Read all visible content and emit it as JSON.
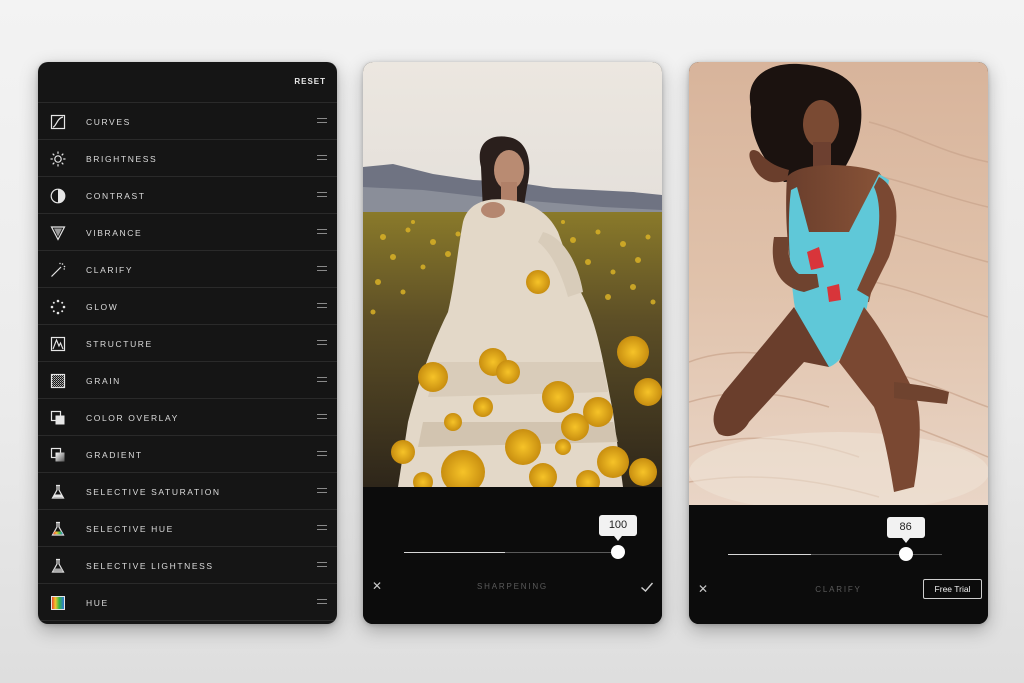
{
  "tools_panel": {
    "reset_label": "RESET",
    "items": [
      {
        "label": "CURVES",
        "icon": "curves-icon"
      },
      {
        "label": "BRIGHTNESS",
        "icon": "brightness-icon"
      },
      {
        "label": "CONTRAST",
        "icon": "contrast-icon"
      },
      {
        "label": "VIBRANCE",
        "icon": "vibrance-icon"
      },
      {
        "label": "CLARIFY",
        "icon": "clarify-icon"
      },
      {
        "label": "GLOW",
        "icon": "glow-icon"
      },
      {
        "label": "STRUCTURE",
        "icon": "structure-icon"
      },
      {
        "label": "GRAIN",
        "icon": "grain-icon"
      },
      {
        "label": "COLOR OVERLAY",
        "icon": "color-overlay-icon"
      },
      {
        "label": "GRADIENT",
        "icon": "gradient-icon"
      },
      {
        "label": "SELECTIVE SATURATION",
        "icon": "selective-saturation-icon"
      },
      {
        "label": "SELECTIVE HUE",
        "icon": "selective-hue-icon"
      },
      {
        "label": "SELECTIVE LIGHTNESS",
        "icon": "selective-lightness-icon"
      },
      {
        "label": "HUE",
        "icon": "hue-icon"
      }
    ]
  },
  "sharpen_panel": {
    "tool_name": "SHARPENING",
    "value": "100",
    "slider_fraction": 1.0,
    "close_icon": "close-icon",
    "apply_icon": "checkmark-icon"
  },
  "clarify_panel": {
    "tool_name": "CLARIFY",
    "value": "86",
    "slider_fraction": 0.83,
    "close_icon": "close-icon",
    "trial_label": "Free Trial"
  },
  "colors": {
    "panel_bg": "#151515",
    "divider": "#2a2a2a",
    "text": "#dcdcdc",
    "caption": "#5b5b5b",
    "swimsuit": "#5fc8d8",
    "flowers": "#e8b21c"
  }
}
